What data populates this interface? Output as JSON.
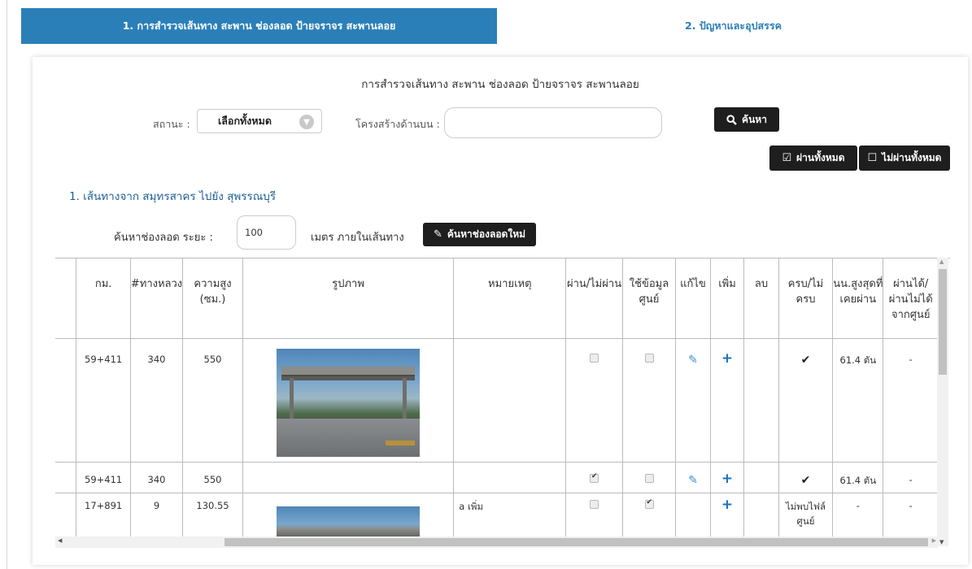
{
  "tabs": [
    {
      "label": "1. การสำรวจเส้นทาง สะพาน ช่องลอด ป้ายจราจร สะพานลอย"
    },
    {
      "label": "2. ปัญหาและอุปสรรค"
    }
  ],
  "panel": {
    "title": "การสำรวจเส้นทาง สะพาน ช่องลอด ป้ายจราจร สะพานลอย"
  },
  "filter": {
    "status_label": "สถานะ :",
    "status_value": "เลือกทั้งหมด",
    "structure_label": "โครงสร้างด้านบน :",
    "structure_value": "",
    "search_button": "ค้นหา"
  },
  "bulk": {
    "pass_all": "ผ่านทั้งหมด",
    "fail_all": "ไม่ผ่านทั้งหมด"
  },
  "route": {
    "title": "1. เส้นทางจาก สมุทรสาคร ไปยัง สุพรรณบุรี",
    "distance_label": "ค้นหาช่องลอด ระยะ :",
    "distance_value": "100",
    "distance_unit": "เมตร ภายในเส้นทาง",
    "new_search_button": "ค้นหาช่องลอดใหม่"
  },
  "table": {
    "headers": {
      "km": "กม.",
      "route_no": "#ทางหลวง",
      "height": "ความสูง (ซม.)",
      "photo": "รูปภาพ",
      "note": "หมายเหตุ",
      "pass": "ผ่าน/ไม่ผ่าน",
      "use_center": "ใช้ข้อมูลศูนย์",
      "edit": "แก้ไข",
      "add": "เพิ่ม",
      "delete": "ลบ",
      "complete": "ครบ/ไม่ครบ",
      "max_weight": "นน.สูงสุดที่เคยผ่าน",
      "center_pass": "ผ่านได้/ผ่านไม่ได้จากศูนย์"
    },
    "rows": [
      {
        "km": "59+411",
        "route_no": "340",
        "height": "550",
        "note": "",
        "max_weight": "61.4 ตัน",
        "center_pass": "-",
        "complete_text": ""
      },
      {
        "km": "59+411",
        "route_no": "340",
        "height": "550",
        "note": "",
        "max_weight": "61.4 ตัน",
        "center_pass": "-",
        "complete_text": ""
      },
      {
        "km": "17+891",
        "route_no": "9",
        "height": "130.55",
        "note": "a เพิ่ม",
        "max_weight": "-",
        "center_pass": "-",
        "complete_text": "ไม่พบไฟล์ศูนย์"
      }
    ]
  }
}
